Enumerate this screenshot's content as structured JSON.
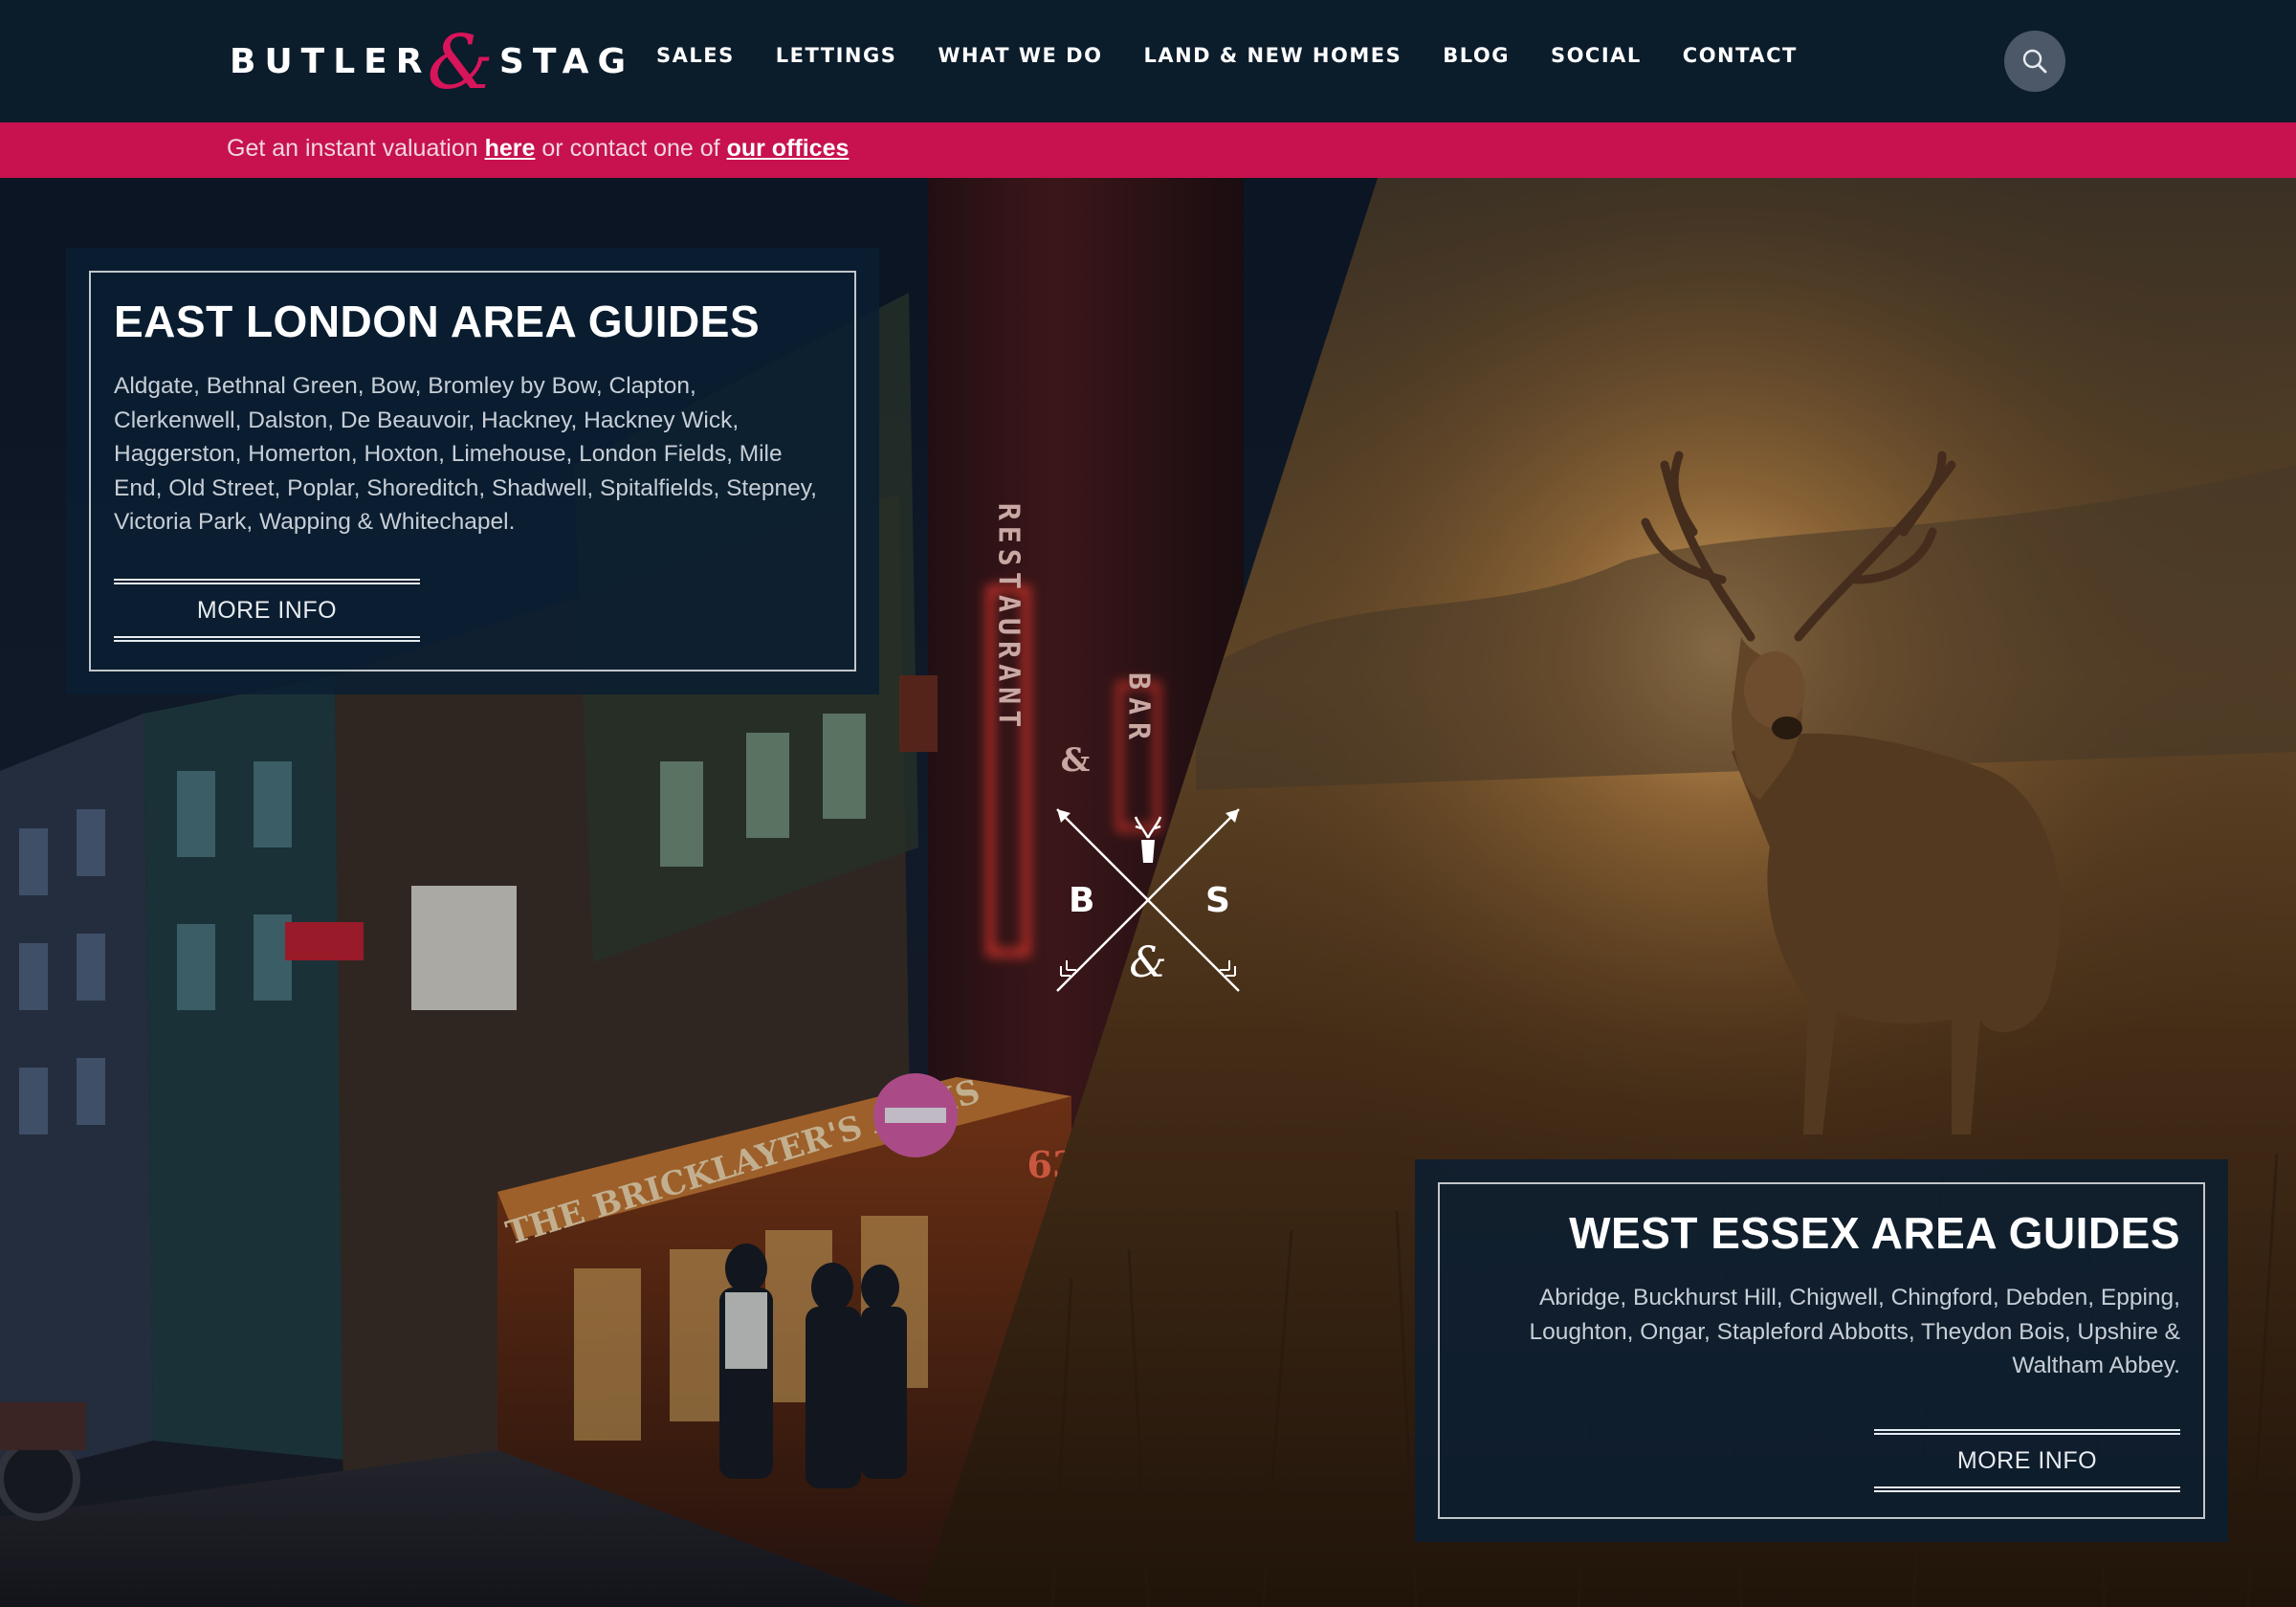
{
  "header": {
    "logo": {
      "left": "BUTLER",
      "amp": "&",
      "right": "STAG"
    },
    "nav": [
      "SALES",
      "LETTINGS",
      "WHAT WE DO",
      "LAND & NEW HOMES",
      "BLOG",
      "SOCIAL",
      "CONTACT"
    ],
    "search_icon": "search-icon"
  },
  "strip": {
    "prefix": "Get an instant valuation",
    "link1": "here",
    "middle": "or contact one of",
    "link2": "our offices"
  },
  "emblem": {
    "left": "B",
    "amp": "&",
    "right": "S"
  },
  "guides": {
    "east": {
      "title": "EAST LONDON AREA GUIDES",
      "description": "Aldgate, Bethnal Green, Bow, Bromley by Bow, Clapton, Clerkenwell, Dalston, De Beauvoir, Hackney, Hackney Wick, Haggerston, Homerton, Hoxton, Limehouse, London Fields, Mile End, Old Street, Poplar, Shoreditch, Shadwell, Spitalfields, Stepney, Victoria Park, Wapping & Whitechapel.",
      "button": "MORE INFO"
    },
    "west": {
      "title": "WEST ESSEX AREA GUIDES",
      "description": "Abridge, Buckhurst Hill, Chigwell, Chingford, Debden, Epping, Loughton, Ongar, Stapleford Abbotts, Theydon Bois, Upshire & Waltham Abbey.",
      "button": "MORE INFO"
    }
  },
  "photo_text": {
    "sign_vertical_1": "RESTAURANT",
    "sign_amp": "&",
    "sign_vertical_2": "BAR",
    "pub_name": "THE BRICKLAYER'S ARMS",
    "street_number": "63"
  },
  "colors": {
    "header_bg": "#0b1c2b",
    "accent": "#c7124f",
    "panel_bg": "#0a1e32"
  }
}
